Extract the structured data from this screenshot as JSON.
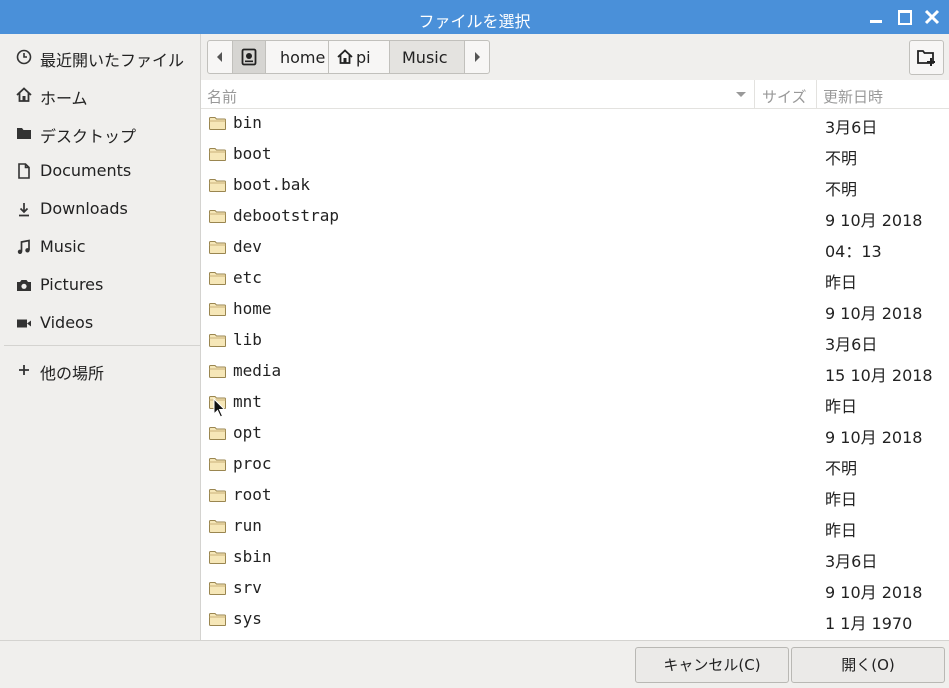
{
  "window": {
    "title": "ファイルを選択"
  },
  "sidebar": {
    "items": [
      {
        "label": "最近開いたファイル",
        "icon": "clock-icon"
      },
      {
        "label": "ホーム",
        "icon": "home-icon"
      },
      {
        "label": "デスクトップ",
        "icon": "folder-icon"
      },
      {
        "label": "Documents",
        "icon": "document-icon"
      },
      {
        "label": "Downloads",
        "icon": "download-icon"
      },
      {
        "label": "Music",
        "icon": "music-icon"
      },
      {
        "label": "Pictures",
        "icon": "camera-icon"
      },
      {
        "label": "Videos",
        "icon": "video-icon"
      }
    ],
    "other_locations": {
      "label": "他の場所",
      "icon": "plus-icon"
    }
  },
  "pathbar": {
    "segments": [
      "home",
      "pi",
      "Music"
    ]
  },
  "columns": {
    "name": "名前",
    "size": "サイズ",
    "modified": "更新日時"
  },
  "files": [
    {
      "name": "bin",
      "date": "3月6日"
    },
    {
      "name": "boot",
      "date": "不明"
    },
    {
      "name": "boot.bak",
      "date": "不明"
    },
    {
      "name": "debootstrap",
      "date": "9  10月  2018"
    },
    {
      "name": "dev",
      "date": "04：13"
    },
    {
      "name": "etc",
      "date": "昨日"
    },
    {
      "name": "home",
      "date": "9  10月  2018"
    },
    {
      "name": "lib",
      "date": "3月6日"
    },
    {
      "name": "media",
      "date": "15  10月  2018"
    },
    {
      "name": "mnt",
      "date": "昨日"
    },
    {
      "name": "opt",
      "date": "9  10月  2018"
    },
    {
      "name": "proc",
      "date": "不明"
    },
    {
      "name": "root",
      "date": "昨日"
    },
    {
      "name": "run",
      "date": "昨日"
    },
    {
      "name": "sbin",
      "date": "3月6日"
    },
    {
      "name": "srv",
      "date": "9  10月  2018"
    },
    {
      "name": "sys",
      "date": "1   1月  1970"
    }
  ],
  "buttons": {
    "cancel": "キャンセル(C)",
    "open": "開く(O)"
  },
  "colors": {
    "titlebar": "#4a90d9",
    "folder": "#f4e3b0"
  }
}
